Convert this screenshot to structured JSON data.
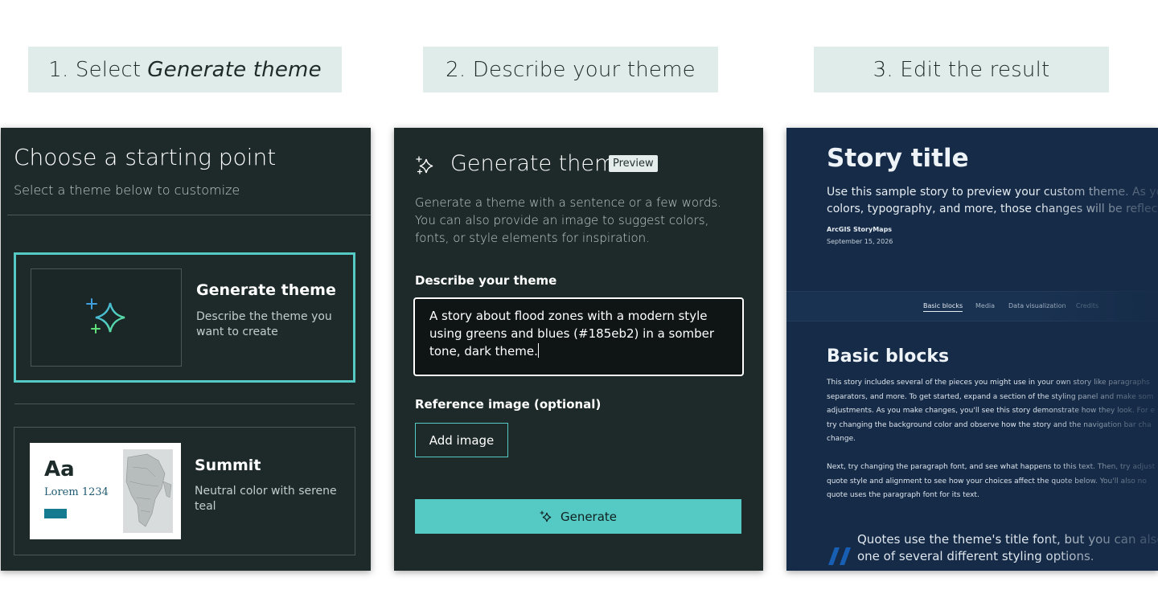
{
  "steps": {
    "step1_prefix": "1. Select",
    "step1_em": "Generate theme",
    "step2": "2. Describe your theme",
    "step3": "3. Edit the result"
  },
  "starting_point": {
    "title": "Choose a starting point",
    "subtitle": "Select a theme below to customize",
    "cards": [
      {
        "name": "Generate theme",
        "description": "Describe the theme you want to create",
        "icon": "sparkle-icon"
      },
      {
        "name": "Summit",
        "description": "Neutral color with serene teal",
        "preview_aa": "Aa",
        "preview_lorem": "Lorem 1234"
      }
    ]
  },
  "generate_theme": {
    "title": "Generate theme",
    "badge": "Preview",
    "intro": "Generate a theme with a sentence or a few words. You can also provide an image to suggest colors, fonts, or style elements for inspiration.",
    "describe_label": "Describe your theme",
    "description_value": "A story about flood zones with a modern style using greens and blues (#185eb2) in a somber tone, dark theme.",
    "reference_label": "Reference image (optional)",
    "add_image_label": "Add image",
    "generate_label": "Generate"
  },
  "story_preview": {
    "title": "Story title",
    "subtitle": "Use this sample story to preview your custom theme. As you m\ncolors, typography, and more, those changes will be reflected",
    "brand": "ArcGIS StoryMaps",
    "date": "September 15, 2026",
    "tabs": [
      "Basic blocks",
      "Media",
      "Data visualization",
      "Credits"
    ],
    "section_title": "Basic blocks",
    "para1": "This story includes several of the pieces you might use in your own story like paragraphs\nseparators, and more. To get started, expand a section of the styling panel and make som\nadjustments. As you make changes, you'll see this story demonstrate how they look. For e\ntry changing the background color and observe how the story and the navigation bar cha\nchange.",
    "para2": "Next, try changing the paragraph font, and see what happens to this text. Then, try adjust\nquote style and alignment to see how your choices affect the quote below. You'll also no\nquote uses the paragraph font for its text.",
    "quote": "Quotes use the theme's title font, but you can also ch\none of several different styling options."
  },
  "colors": {
    "accent_teal": "#55c9c3",
    "panel_dark": "#1e2a2a",
    "story_navy": "#152b47",
    "step_label_bg": "#dfecea",
    "quote_blue": "#185eb2"
  }
}
